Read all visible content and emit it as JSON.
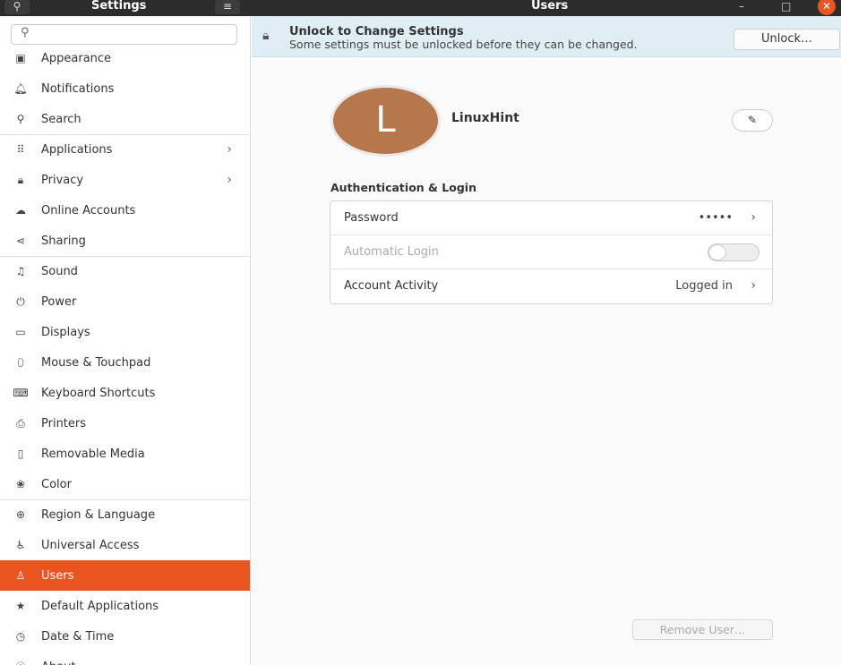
{
  "headerbar": {
    "sidebar_title": "Settings",
    "main_title": "Users"
  },
  "sidebar": {
    "items": [
      {
        "label": "Appearance",
        "icon": "appearance-icon",
        "glyph": "▣"
      },
      {
        "label": "Notifications",
        "icon": "bell-icon",
        "glyph": "🔔︎"
      },
      {
        "label": "Search",
        "icon": "search-icon",
        "glyph": "⚲"
      },
      {
        "label": "Applications",
        "icon": "apps-grid-icon",
        "glyph": "⠿",
        "chevron": true
      },
      {
        "label": "Privacy",
        "icon": "lock-icon",
        "glyph": "🔒︎",
        "chevron": true
      },
      {
        "label": "Online Accounts",
        "icon": "cloud-icon",
        "glyph": "☁"
      },
      {
        "label": "Sharing",
        "icon": "share-icon",
        "glyph": "⋖"
      },
      {
        "label": "Sound",
        "icon": "music-note-icon",
        "glyph": "♫"
      },
      {
        "label": "Power",
        "icon": "power-icon",
        "glyph": "⏻"
      },
      {
        "label": "Displays",
        "icon": "display-icon",
        "glyph": "▭"
      },
      {
        "label": "Mouse & Touchpad",
        "icon": "mouse-icon",
        "glyph": "⬯"
      },
      {
        "label": "Keyboard Shortcuts",
        "icon": "keyboard-icon",
        "glyph": "⌨"
      },
      {
        "label": "Printers",
        "icon": "printer-icon",
        "glyph": "⎙"
      },
      {
        "label": "Removable Media",
        "icon": "media-icon",
        "glyph": "▯"
      },
      {
        "label": "Color",
        "icon": "color-icon",
        "glyph": "❀"
      },
      {
        "label": "Region & Language",
        "icon": "globe-icon",
        "glyph": "⊕"
      },
      {
        "label": "Universal Access",
        "icon": "accessibility-icon",
        "glyph": "♿︎"
      },
      {
        "label": "Users",
        "icon": "user-icon",
        "glyph": "♙",
        "selected": true
      },
      {
        "label": "Default Applications",
        "icon": "star-icon",
        "glyph": "★"
      },
      {
        "label": "Date & Time",
        "icon": "clock-icon",
        "glyph": "◷"
      },
      {
        "label": "About",
        "icon": "info-icon",
        "glyph": "ⓘ"
      }
    ]
  },
  "banner": {
    "title": "Unlock to Change Settings",
    "subtitle": "Some settings must be unlocked before they can be changed.",
    "button": "Unlock…"
  },
  "user": {
    "initial": "L",
    "name": "LinuxHint"
  },
  "auth": {
    "heading": "Authentication & Login",
    "password_label": "Password",
    "password_value": "•••••",
    "autologin_label": "Automatic Login",
    "autologin_on": false,
    "activity_label": "Account Activity",
    "activity_value": "Logged in"
  },
  "remove_button": "Remove User…",
  "colors": {
    "accent": "#e95420",
    "avatar": "#b5774b"
  }
}
